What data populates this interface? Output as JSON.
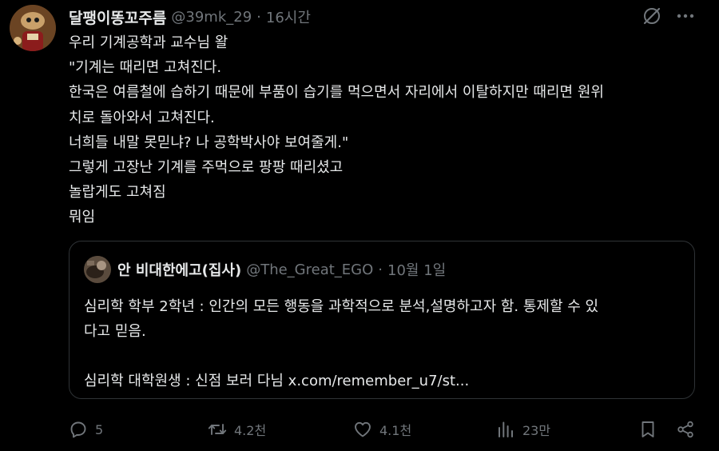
{
  "tweet": {
    "display_name": "달팽이똥꼬주름",
    "handle": "@39mk_29",
    "separator": "·",
    "time": "16시간",
    "text_lines": [
      "우리 기계공학과 교수님 왈",
      "\"기계는 때리면 고쳐진다.",
      "한국은 여름철에 습하기 때문에 부품이 습기를 먹으면서 자리에서 이탈하지만 때리면 원위",
      "치로 돌아와서 고쳐진다.",
      "너희들 내말 못믿냐? 나 공학박사야 보여줄게.\"",
      "그렇게 고장난 기계를 주먹으로 팡팡 때리셨고",
      "놀랍게도 고쳐짐",
      "뭐임"
    ]
  },
  "quote": {
    "display_name": "안 비대한에고(집사)",
    "handle": "@The_Great_EGO",
    "separator": "·",
    "time": "10월 1일",
    "text_lines": [
      "심리학 학부 2학년 : 인간의 모든 행동을 과학적으로 분석,설명하고자 함. 통제할 수 있",
      "다고 믿음.",
      "",
      "심리학 대학원생 : 신점 보러 다님 x.com/remember_u7/st..."
    ]
  },
  "actions": {
    "reply_count": "5",
    "retweet_count": "4.2천",
    "like_count": "4.1천",
    "view_count": "23만"
  },
  "icons": {
    "grok": "grok-icon",
    "more": "more-icon",
    "reply": "reply-icon",
    "retweet": "retweet-icon",
    "like": "heart-icon",
    "views": "views-icon",
    "bookmark": "bookmark-icon",
    "share": "share-icon"
  },
  "colors": {
    "background": "#000000",
    "text_primary": "#e7e9ea",
    "text_secondary": "#71767b",
    "border": "#2f3336"
  }
}
